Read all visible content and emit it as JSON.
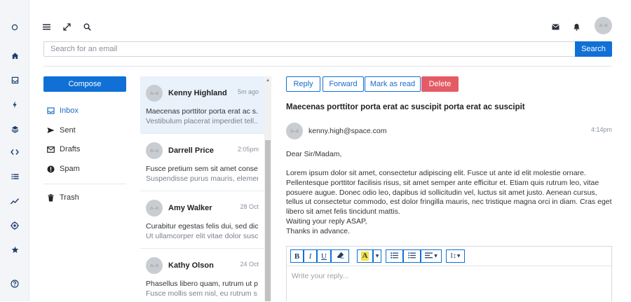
{
  "rail": {
    "icons": [
      "circle-icon",
      "home-icon",
      "inbox-icon",
      "bolt-icon",
      "layers-icon",
      "code-icon",
      "list-icon",
      "chart-line-icon",
      "target-icon",
      "star-icon",
      "help-icon"
    ]
  },
  "topbar": {
    "icons": [
      "menu-icon",
      "expand-icon",
      "search-icon",
      "mail-icon",
      "bell-icon"
    ],
    "avatar_text": "a–a"
  },
  "search": {
    "placeholder": "Search for an email",
    "button_label": "Search"
  },
  "sidebar": {
    "compose_label": "Compose",
    "folders": [
      {
        "label": "Inbox",
        "icon": "inbox-icon",
        "active": true
      },
      {
        "label": "Sent",
        "icon": "send-icon",
        "active": false
      },
      {
        "label": "Drafts",
        "icon": "envelope-icon",
        "active": false
      },
      {
        "label": "Spam",
        "icon": "alert-icon",
        "active": false
      },
      {
        "label": "Trash",
        "icon": "trash-icon",
        "active": false
      }
    ]
  },
  "emails": [
    {
      "name": "Kenny Highland",
      "time": "5m ago",
      "line1": "Maecenas porttitor porta erat ac s...",
      "line2": "Vestibulum placerat imperdiet tell...",
      "selected": true,
      "avatar_text": "a–a"
    },
    {
      "name": "Darrell Price",
      "time": "2:05pm",
      "line1": "Fusce pretium sem sit amet conse...",
      "line2": "Suspendisse purus mauris, elemen...",
      "selected": false,
      "avatar_text": "a–a"
    },
    {
      "name": "Amy Walker",
      "time": "28 Oct",
      "line1": "Curabitur egestas felis dui, sed dic...",
      "line2": "Ut ullamcorper elit vitae dolor susc...",
      "selected": false,
      "avatar_text": "a–a"
    },
    {
      "name": "Kathy Olson",
      "time": "24 Oct",
      "line1": "Phasellus libero quam, rutrum ut p...",
      "line2": "Fusce mollis sem nisl, eu rutrum s...",
      "selected": false,
      "avatar_text": "a–a"
    }
  ],
  "actions": {
    "reply": "Reply",
    "forward": "Forward",
    "mark_read": "Mark as read",
    "delete": "Delete"
  },
  "message": {
    "subject": "Maecenas porttitor porta erat ac suscipit porta erat ac suscipit",
    "from": "kenny.high@space.com",
    "time": "4:14pm",
    "avatar_text": "a–a",
    "greeting": "Dear Sir/Madam,",
    "body": "Lorem ipsum dolor sit amet, consectetur adipiscing elit. Fusce ut ante id elit molestie ornare. Pellentesque porttitor facilisis risus, sit amet semper ante efficitur et. Etiam quis rutrum leo, vitae posuere augue. Donec odio leo, dapibus id sollicitudin vel, luctus sit amet justo. Aenean cursus, tellus ut consectetur commodo, est dolor fringilla mauris, nec tristique magna orci in diam. Cras eget libero sit amet felis tincidunt mattis.",
    "closing1": "Waiting your reply ASAP,",
    "closing2": "Thanks in advance."
  },
  "editor": {
    "placeholder": "Write your reply...",
    "bold": "B",
    "italic": "I",
    "underline": "U",
    "text_height": "I↕"
  }
}
